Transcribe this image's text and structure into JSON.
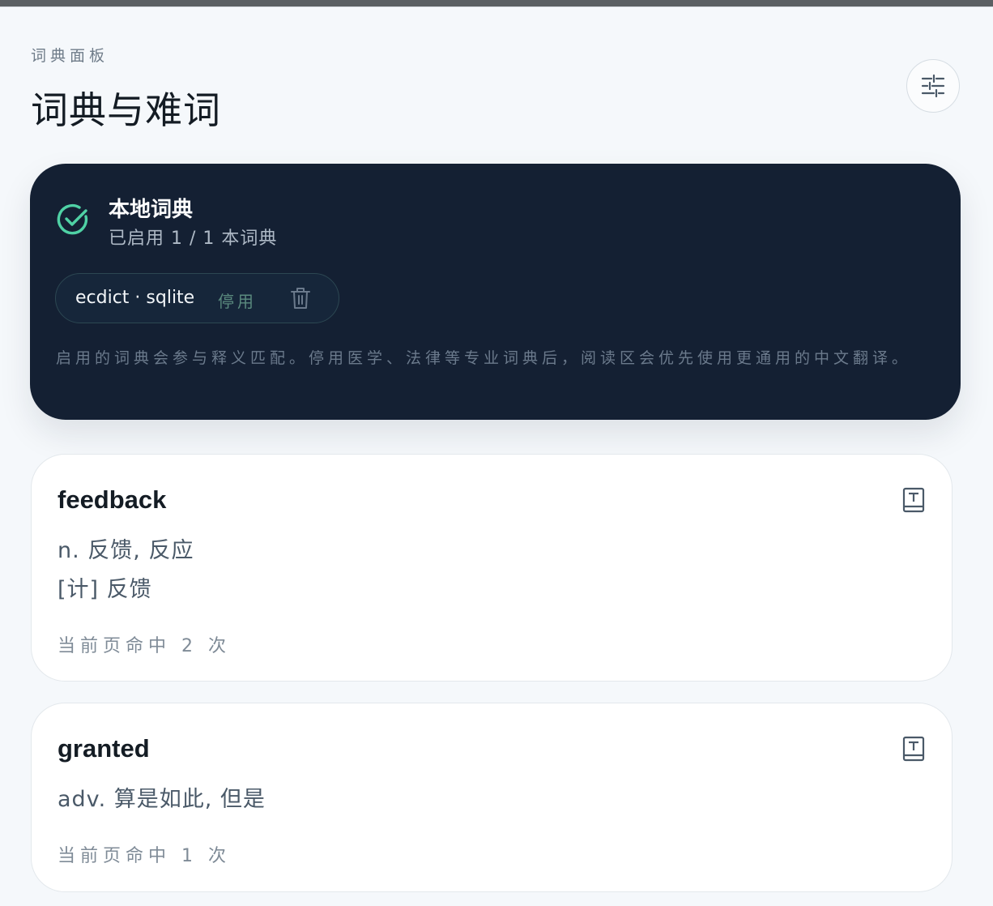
{
  "header": {
    "kicker": "词典面板",
    "title": "词典与难词",
    "settings_icon": "sliders-icon"
  },
  "dictionary": {
    "title": "本地词典",
    "subtitle": "已启用 1 / 1 本词典",
    "status_icon": "check-circle-icon",
    "accent_color": "#4fd1a5",
    "items": [
      {
        "name": "ecdict · sqlite",
        "toggle_label": "停用",
        "delete_icon": "trash-icon"
      }
    ],
    "note": "启用的词典会参与释义匹配。停用医学、法律等专业词典后，阅读区会优先使用更通用的中文翻译。"
  },
  "words": [
    {
      "word": "feedback",
      "definitions": [
        "n. 反馈, 反应",
        "[计] 反馈"
      ],
      "hits": "当前页命中 2 次",
      "icon": "book-icon"
    },
    {
      "word": "granted",
      "definitions": [
        "adv. 算是如此, 但是"
      ],
      "hits": "当前页命中 1 次",
      "icon": "book-icon"
    }
  ]
}
